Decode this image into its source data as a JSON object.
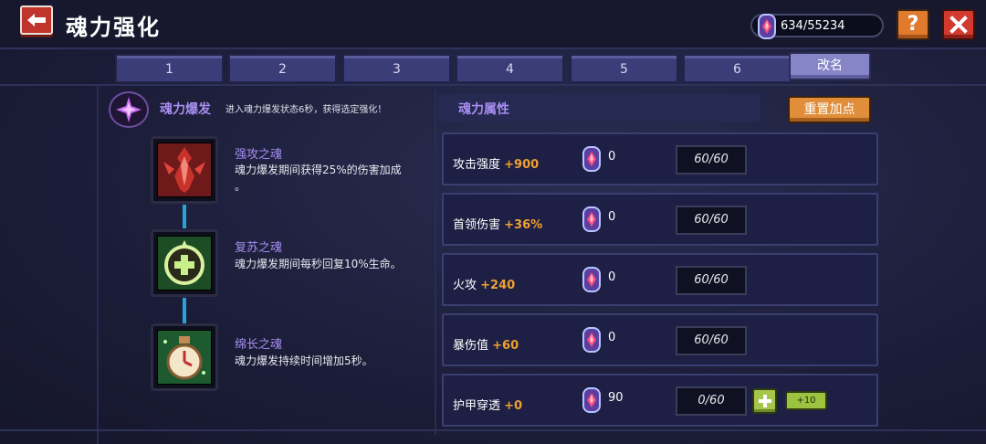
{
  "header": {
    "title": "魂力强化",
    "currency_value": "634/55234",
    "help_label": "?"
  },
  "tabs": [
    "1",
    "2",
    "3",
    "4",
    "5",
    "6"
  ],
  "rename_label": "改名",
  "burst": {
    "title": "魂力爆发",
    "description": "进入魂力爆发状态6秒，获得选定强化！"
  },
  "skills": [
    {
      "name": "强攻之魂",
      "desc_line1": "魂力爆发期间获得25%的伤害加成",
      "desc_line2": "。"
    },
    {
      "name": "复苏之魂",
      "desc_line1": "魂力爆发期间每秒回复10%生命。",
      "desc_line2": ""
    },
    {
      "name": "绵长之魂",
      "desc_line1": "魂力爆发持续时间增加5秒。",
      "desc_line2": ""
    }
  ],
  "attributes": {
    "header": "魂力属性",
    "reset_label": "重置加点",
    "rows": [
      {
        "name": "攻击强度",
        "bonus": "+900",
        "cost": "0",
        "level": "60/60"
      },
      {
        "name": "首领伤害",
        "bonus": "+36%",
        "cost": "0",
        "level": "60/60"
      },
      {
        "name": "火攻",
        "bonus": "+240",
        "cost": "0",
        "level": "60/60"
      },
      {
        "name": "暴伤值",
        "bonus": "+60",
        "cost": "0",
        "level": "60/60"
      },
      {
        "name": "护甲穿透",
        "bonus": "+0",
        "cost": "90",
        "level": "0/60",
        "plus10_label": "+10"
      }
    ]
  },
  "colors": {
    "accent_purple": "#a78ef0",
    "bonus_orange": "#f0a030",
    "connector_blue": "#2aa2d8"
  },
  "icons": {
    "back": "arrow-left-icon",
    "currency": "soul-gem-icon",
    "close": "close-icon",
    "burst": "soul-burst-icon",
    "skills": [
      "red-claw-icon",
      "green-heal-icon",
      "clock-potion-icon"
    ]
  }
}
